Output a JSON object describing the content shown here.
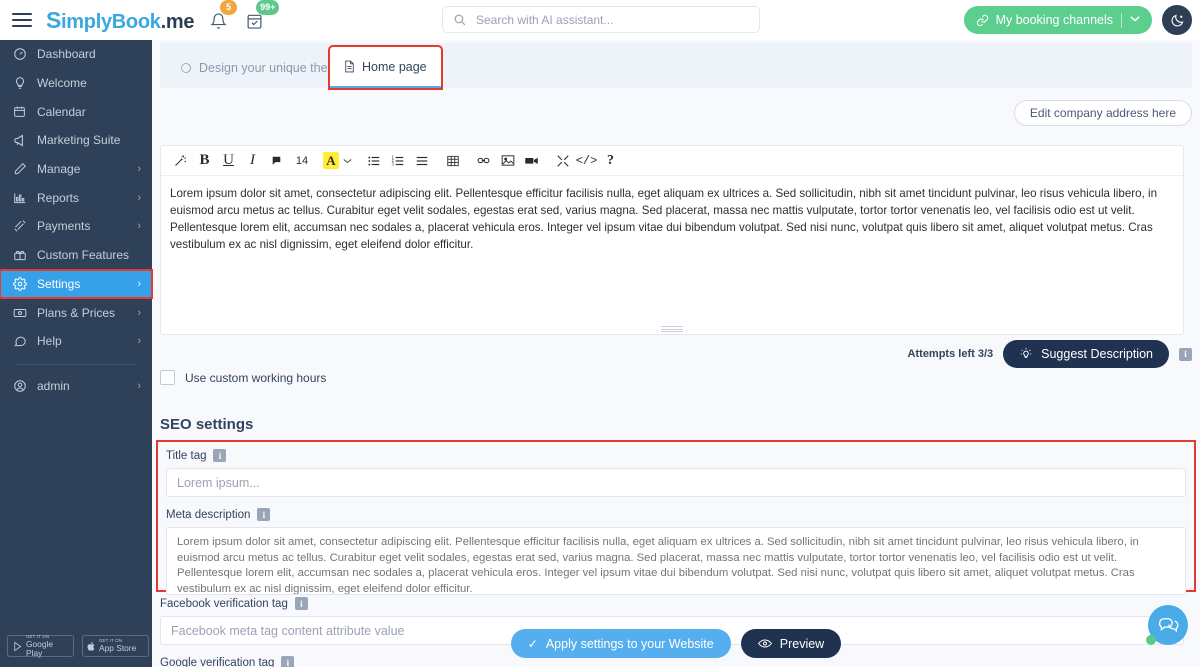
{
  "topbar": {
    "logo_s": "S",
    "logo_blue": "implyBook",
    "logo_dark": ".me",
    "bell_badge": "5",
    "calendar_badge": "99+",
    "search_placeholder": "Search with AI assistant...",
    "search_value": "",
    "booking_channels_label": "My booking channels",
    "booking_caret": "⌄",
    "theme_toggle_name": "dark-mode-toggle"
  },
  "sidebar": {
    "items": [
      {
        "label": "Dashboard",
        "icon": "speedometer-icon",
        "chevron": "",
        "active": false,
        "name": "sidebar-item-dashboard"
      },
      {
        "label": "Welcome",
        "icon": "lightbulb-icon",
        "chevron": "",
        "active": false,
        "name": "sidebar-item-welcome"
      },
      {
        "label": "Calendar",
        "icon": "calendar-icon",
        "chevron": "",
        "active": false,
        "name": "sidebar-item-calendar"
      },
      {
        "label": "Marketing Suite",
        "icon": "megaphone-icon",
        "chevron": "",
        "active": false,
        "name": "sidebar-item-marketing-suite"
      },
      {
        "label": "Manage",
        "icon": "pencil-icon",
        "chevron": "›",
        "active": false,
        "name": "sidebar-item-manage"
      },
      {
        "label": "Reports",
        "icon": "bar-chart-icon",
        "chevron": "›",
        "active": false,
        "name": "sidebar-item-reports"
      },
      {
        "label": "Payments",
        "icon": "banknotes-icon",
        "chevron": "›",
        "active": false,
        "name": "sidebar-item-payments"
      },
      {
        "label": "Custom Features",
        "icon": "gift-icon",
        "chevron": "",
        "active": false,
        "name": "sidebar-item-custom-features"
      },
      {
        "label": "Settings",
        "icon": "gear-icon",
        "chevron": "›",
        "active": true,
        "name": "sidebar-item-settings"
      },
      {
        "label": "Plans & Prices",
        "icon": "money-icon",
        "chevron": "›",
        "active": false,
        "name": "sidebar-item-plans-prices"
      },
      {
        "label": "Help",
        "icon": "chat-bubble-icon",
        "chevron": "›",
        "active": false,
        "name": "sidebar-item-help"
      }
    ],
    "account": {
      "label": "admin",
      "chevron": "›"
    },
    "store_badges": [
      {
        "top": "GET IT ON",
        "main": "Google Play",
        "icon": "google-play-icon"
      },
      {
        "top": "GET IT ON",
        "main": "App Store",
        "icon": "apple-icon"
      }
    ]
  },
  "tabs": [
    {
      "label": "Design your unique theme",
      "icon": "palette-icon",
      "active": false
    },
    {
      "label": "Home page",
      "icon": "document-icon",
      "active": true
    }
  ],
  "company_address_button": "Edit company address here",
  "editor": {
    "toolbar": [
      {
        "icon": "magic-wand-icon",
        "glyph": "",
        "name": "magic-wand-button"
      },
      {
        "icon": "bold-icon",
        "glyph": "B",
        "name": "bold-button"
      },
      {
        "icon": "underline-icon",
        "glyph": "U",
        "name": "underline-button"
      },
      {
        "icon": "italic-icon",
        "glyph": "I",
        "name": "italic-button"
      },
      {
        "icon": "eraser-icon",
        "glyph": "",
        "name": "clear-format-button"
      },
      {
        "icon": "font-size-icon",
        "glyph": "14",
        "name": "font-size-button"
      },
      {
        "icon": "text-color-icon",
        "glyph": "A",
        "name": "text-color-button"
      },
      {
        "icon": "chevron-down-icon",
        "glyph": "⌄",
        "name": "text-color-dropdown"
      },
      {
        "icon": "bullet-list-icon",
        "glyph": "",
        "name": "bullet-list-button"
      },
      {
        "icon": "numbered-list-icon",
        "glyph": "",
        "name": "numbered-list-button"
      },
      {
        "icon": "align-icon",
        "glyph": "",
        "name": "align-button"
      },
      {
        "icon": "table-icon",
        "glyph": "",
        "name": "insert-table-button"
      },
      {
        "icon": "link-icon",
        "glyph": "",
        "name": "insert-link-button"
      },
      {
        "icon": "image-icon",
        "glyph": "",
        "name": "insert-image-button"
      },
      {
        "icon": "video-icon",
        "glyph": "",
        "name": "insert-video-button"
      },
      {
        "icon": "fullscreen-icon",
        "glyph": "",
        "name": "fullscreen-button"
      },
      {
        "icon": "code-icon",
        "glyph": "</>",
        "name": "source-code-button"
      },
      {
        "icon": "help-icon",
        "glyph": "?",
        "name": "help-button"
      }
    ],
    "font_size_value": "14",
    "content": "Lorem ipsum dolor sit amet, consectetur adipiscing elit. Pellentesque efficitur facilisis nulla, eget aliquam ex ultrices a. Sed sollicitudin, nibh sit amet tincidunt pulvinar, leo risus vehicula libero, in euismod arcu metus ac tellus. Curabitur eget velit sodales, egestas erat sed, varius magna. Sed placerat, massa nec mattis vulputate, tortor tortor venenatis leo, vel facilisis odio est ut velit. Pellentesque lorem elit, accumsan nec sodales a, placerat vehicula eros. Integer vel ipsum vitae dui bibendum volutpat. Sed nisi nunc, volutpat quis libero sit amet, aliquet volutpat metus. Cras vestibulum ex ac nisl dignissim, eget eleifend dolor efficitur."
  },
  "suggest": {
    "attempts_label": "Attempts left 3/3",
    "button_label": "Suggest Description",
    "info_glyph": "i"
  },
  "custom_working_hours": {
    "label": "Use custom working hours",
    "checked": false
  },
  "seo": {
    "heading": "SEO settings",
    "title_tag": {
      "label": "Title tag",
      "info_glyph": "i",
      "value": "",
      "placeholder": "Lorem ipsum..."
    },
    "meta_description": {
      "label": "Meta description",
      "info_glyph": "i",
      "value": "",
      "placeholder": "Lorem ipsum dolor sit amet, consectetur adipiscing elit. Pellentesque efficitur facilisis nulla, eget aliquam ex ultrices a. Sed sollicitudin, nibh sit amet tincidunt pulvinar, leo risus vehicula libero, in euismod arcu metus ac tellus. Curabitur eget velit sodales, egestas erat sed, varius magna. Sed placerat, massa nec mattis vulputate, tortor tortor venenatis leo, vel facilisis odio est ut velit. Pellentesque lorem elit, accumsan nec sodales a, placerat vehicula eros. Integer vel ipsum vitae dui bibendum volutpat. Sed nisi nunc, volutpat quis libero sit amet, aliquet volutpat metus. Cras vestibulum ex ac nisl dignissim, eget eleifend dolor efficitur."
    },
    "facebook_tag": {
      "label": "Facebook verification tag",
      "info_glyph": "i",
      "value": "",
      "placeholder": "Facebook meta tag content attribute value"
    },
    "google_tag": {
      "label": "Google verification tag",
      "info_glyph": "i"
    }
  },
  "footer": {
    "apply_label": "Apply settings to your Website",
    "apply_check": "✓",
    "preview_label": "Preview"
  },
  "colors": {
    "sidebar_bg": "#2e4158",
    "accent_blue": "#36a0e8",
    "green": "#5cce8e",
    "dark_navy": "#1f3350",
    "highlight_red": "#e23b2e",
    "page_bg": "#f7f9fc"
  }
}
